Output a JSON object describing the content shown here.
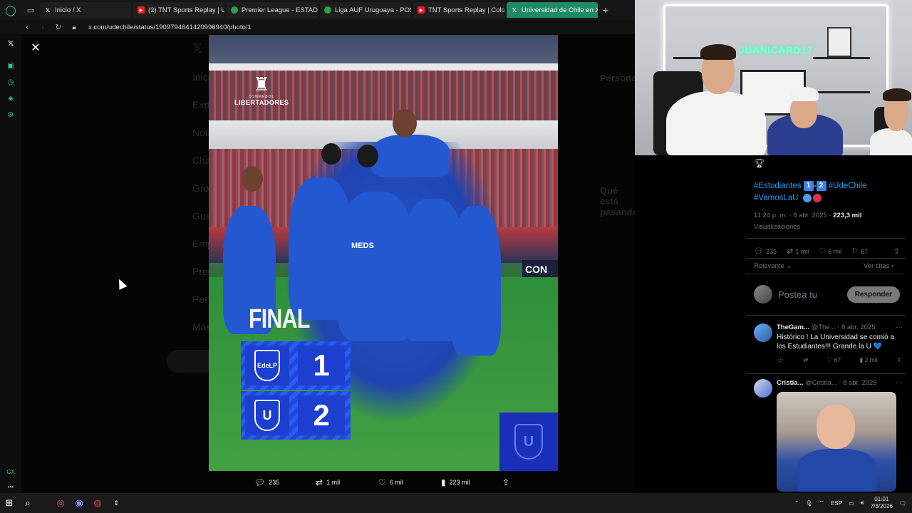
{
  "browser": {
    "tabs": [
      {
        "label": "Inicio / X",
        "icon": "x-icon"
      },
      {
        "label": "(2) TNT Sports Replay | U",
        "icon": "youtube-icon"
      },
      {
        "label": "Premier League - ESTADÍ",
        "icon": "green-icon"
      },
      {
        "label": "Liga AUF Uruguaya - POS",
        "icon": "green-icon"
      },
      {
        "label": "TNT Sports Replay | Colo",
        "icon": "youtube-icon"
      },
      {
        "label": "Universidad de Chile en X",
        "icon": "x-icon",
        "active": true
      }
    ],
    "url": "x.com/udechile/status/1909794641420996940/photo/1"
  },
  "background_nav": [
    "Inicio",
    "Explorar",
    "Notificaciones",
    "Chat",
    "Grok",
    "Guardados",
    "Empleos",
    "Premium",
    "Perfil",
    "Más"
  ],
  "background_right": {
    "persons": "Personas",
    "trending": "Qué está pasando"
  },
  "photo": {
    "competition_line1": "CONMEBOL",
    "competition_line2": "LIBERTADORES",
    "final_label": "FINAL",
    "home_crest": "EdeLP",
    "home_score": "1",
    "away_crest": "U",
    "away_score": "2",
    "ad_text": "CON",
    "shirt_sponsor": "MEDS"
  },
  "photo_actions": {
    "replies": "235",
    "reposts": "1 mil",
    "likes": "6 mil",
    "views": "223 mil"
  },
  "webcam": {
    "neon_sign": "JUANICARD17"
  },
  "tweet": {
    "hashtag1": "#Estudiantes",
    "score_home": "1",
    "score_away": "2",
    "hashtag2": "#UdeChile",
    "hashtag3": "#VamosLaU",
    "time": "11:24 p. m. · 8 abr. 2025 ·",
    "views_count": "223,3 mil",
    "views_label": "Visualizaciones",
    "stats": {
      "replies": "235",
      "reposts": "1 mil",
      "likes": "6 mil",
      "bookmarks": "67"
    },
    "sort_label": "Relevante",
    "quotes_link": "Ver citas",
    "reply_placeholder": "Postea tu",
    "reply_button": "Responder"
  },
  "comments": [
    {
      "author": "TheGam...",
      "handle": "@The...",
      "date": "· 8 abr. 2025",
      "text": "Histórico ! La Universidad se comió a los Estudiantes!!! Grande la U 💙",
      "likes": "67",
      "views": "2 mil"
    },
    {
      "author": "Cristia...",
      "handle": "@Cristia...",
      "date": "· 8 abr. 2025"
    }
  ],
  "taskbar": {
    "language": "ESP",
    "time": "01:01",
    "date": "7/3/2026"
  }
}
